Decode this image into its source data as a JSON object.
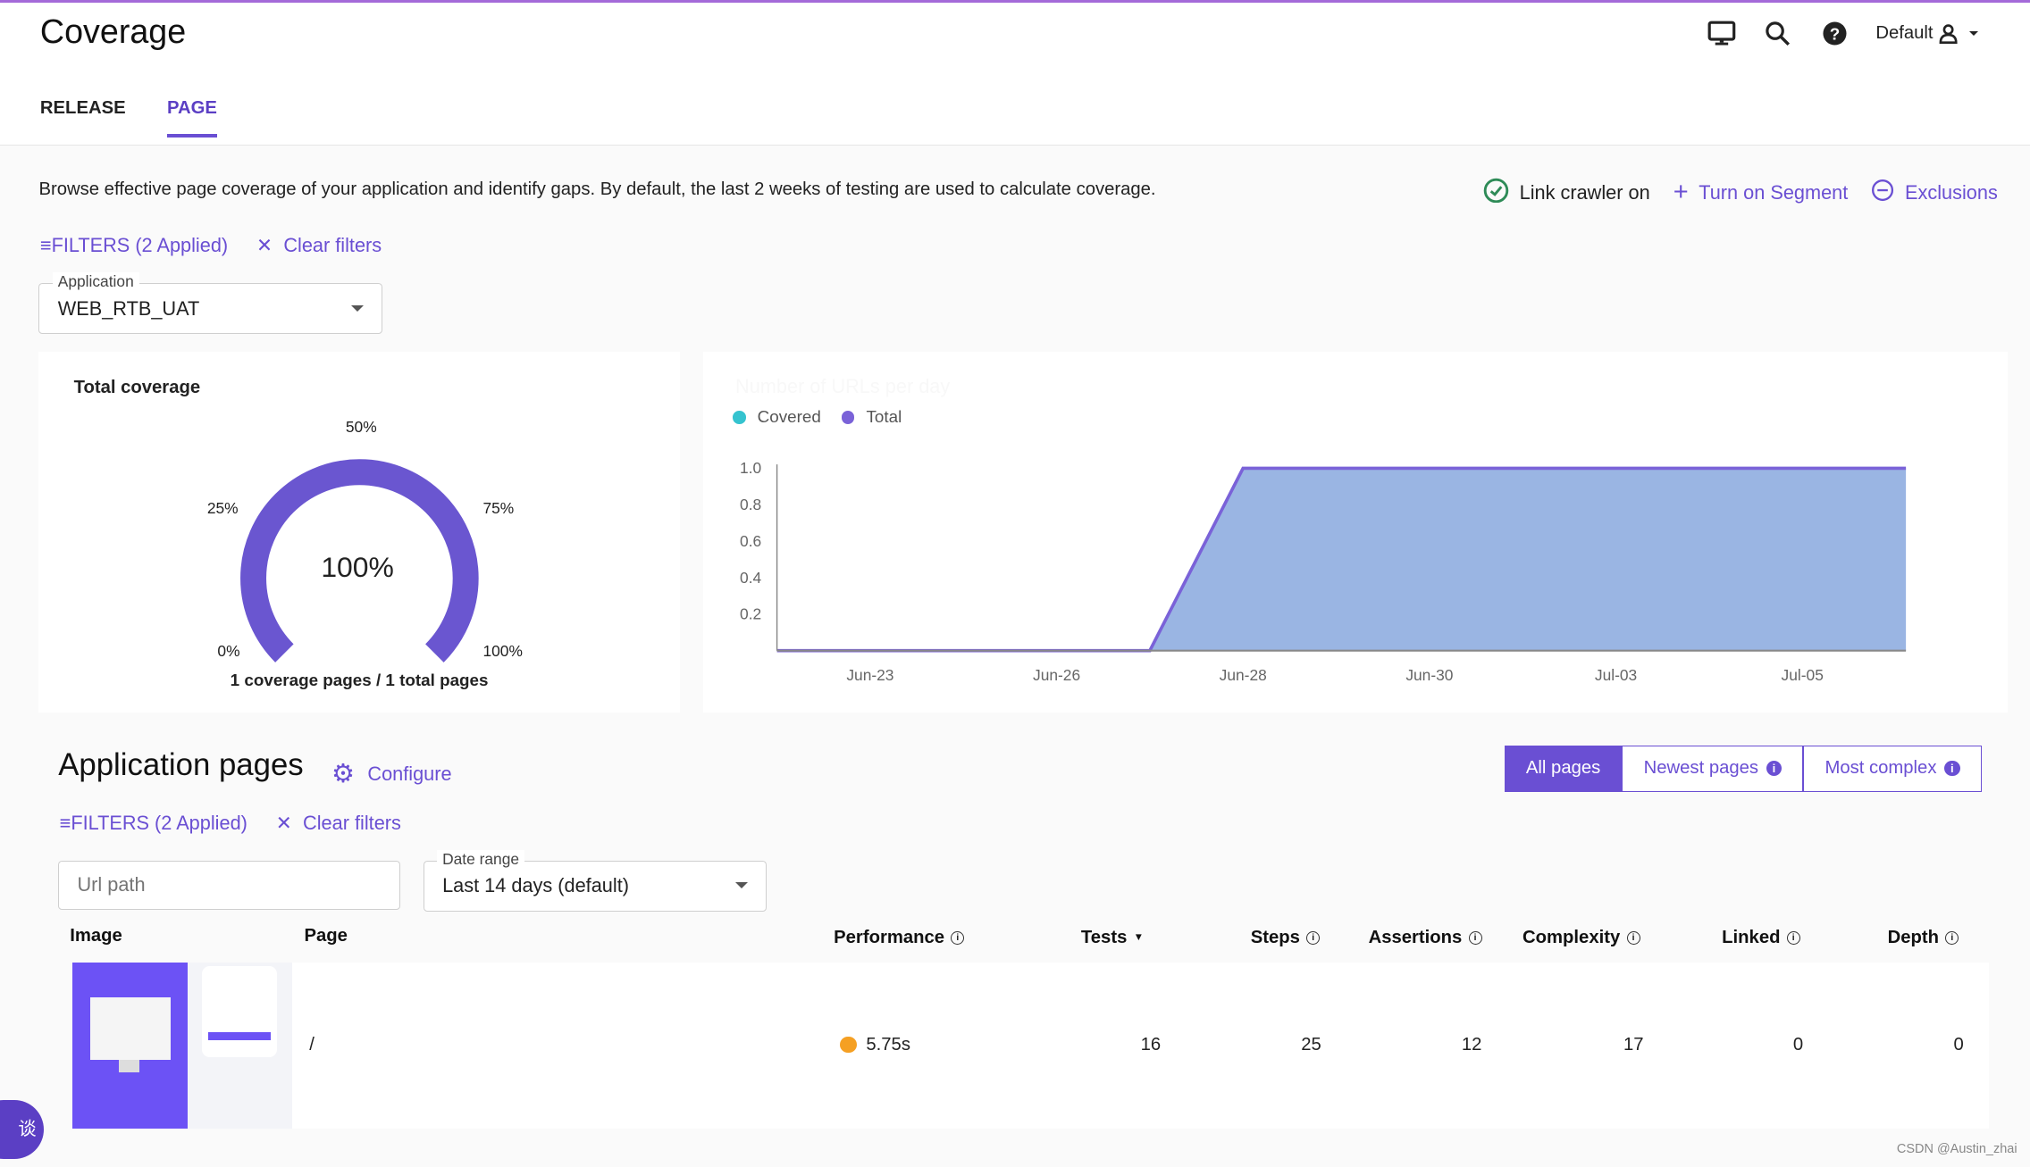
{
  "header": {
    "title": "Coverage",
    "user": "Default",
    "icons": [
      "monitor-icon",
      "search-icon",
      "help-icon",
      "user-icon"
    ]
  },
  "tabs": [
    {
      "label": "RELEASE",
      "active": false
    },
    {
      "label": "PAGE",
      "active": true
    }
  ],
  "description": "Browse effective page coverage of your application and identify gaps. By default, the last 2 weeks of testing are used to calculate coverage.",
  "links": {
    "crawler": "Link crawler on",
    "segment": "Turn on Segment",
    "exclusions": "Exclusions"
  },
  "filters": {
    "label": "FILTERS (2 Applied)",
    "clear": "Clear filters"
  },
  "application": {
    "label": "Application",
    "value": "WEB_RTB_UAT"
  },
  "gauge": {
    "title": "Total coverage",
    "value": "100%",
    "percent": 100,
    "ticks": [
      "0%",
      "25%",
      "50%",
      "75%",
      "100%"
    ],
    "caption": "1 coverage pages / 1 total pages",
    "color": "#6a56d0"
  },
  "chart_data": {
    "type": "area",
    "title": "Number of URLs per day",
    "legend": [
      "Covered",
      "Total"
    ],
    "legend_colors": [
      "#35c3cf",
      "#7a62d8"
    ],
    "x": [
      "",
      "Jun-23",
      "",
      "Jun-26",
      "",
      "Jun-28",
      "",
      "Jun-30",
      "",
      "Jul-03",
      "",
      "Jul-05",
      ""
    ],
    "series": [
      {
        "name": "Covered",
        "values": [
          0,
          0,
          0,
          0,
          0,
          1,
          1,
          1,
          1,
          1,
          1,
          1,
          1
        ]
      },
      {
        "name": "Total",
        "values": [
          0,
          0,
          0,
          0,
          0,
          1,
          1,
          1,
          1,
          1,
          1,
          1,
          1
        ]
      }
    ],
    "yticks": [
      "0.2",
      "0.4",
      "0.6",
      "0.8",
      "1.0"
    ],
    "ylim": [
      0,
      1
    ],
    "grid": false,
    "legend_position": "top-left"
  },
  "pages": {
    "title": "Application pages",
    "configure": "Configure",
    "views": [
      "All pages",
      "Newest pages",
      "Most complex"
    ],
    "url_placeholder": "Url path",
    "date_range": {
      "label": "Date range",
      "value": "Last 14 days (default)"
    },
    "columns": [
      "Image",
      "Page",
      "Performance",
      "Tests",
      "Steps",
      "Assertions",
      "Complexity",
      "Linked",
      "Depth"
    ],
    "rows": [
      {
        "page": "/",
        "performance": "5.75s",
        "perf_color": "#f5a023",
        "tests": "16",
        "steps": "25",
        "assertions": "12",
        "complexity": "17",
        "linked": "0",
        "depth": "0"
      }
    ]
  },
  "chat": "谈",
  "watermark": "CSDN @Austin_zhai"
}
